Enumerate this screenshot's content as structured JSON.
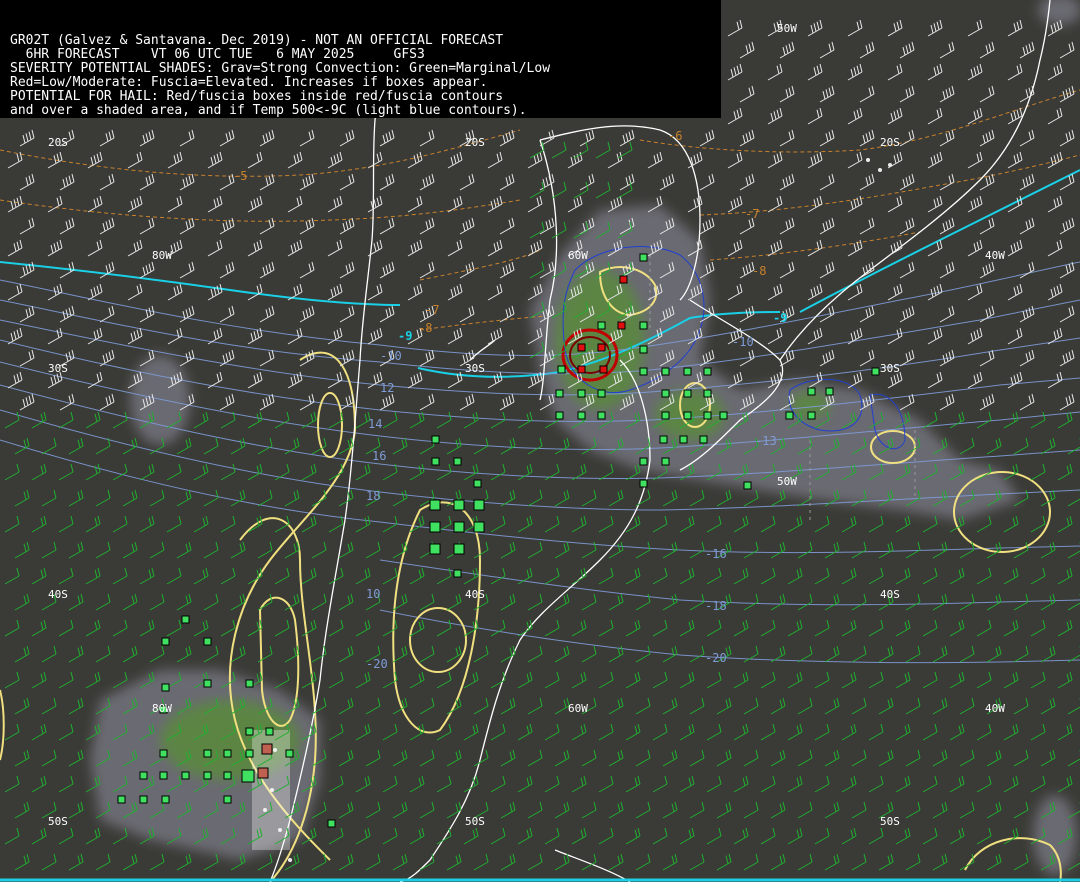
{
  "header": {
    "lines": [
      "GR02T (Galvez & Santavana. Dec 2019) - NOT AN OFFICIAL FORECAST",
      "  6HR FORECAST    VT 06 UTC TUE   6 MAY 2025     GFS3",
      "SEVERITY POTENTIAL SHADES: Grav=Strong Convection: Green=Marginal/Low",
      "Red=Low/Moderate: Fuscia=Elevated. Increases if boxes appear.",
      "POTENTIAL FOR HAIL: Red/fuscia boxes inside red/fuscia contours",
      "and over a shaded area, and if Temp 500<-9C (light blue contours)."
    ]
  },
  "grid_labels": {
    "lat_20s": "20S",
    "lat_30s": "30S",
    "lat_40s": "40S",
    "lat_50s": "50S",
    "lon_80w": "80W",
    "lon_60w": "60W",
    "lon_50w": "50W",
    "lon_40w": "40W"
  },
  "contour_labels": {
    "t_m5": "-5",
    "t_m6": "-6",
    "t_m7": "-7",
    "t_m8": "-8",
    "t_m9": "-9",
    "t_m10": "-10",
    "t_m13": "-13",
    "t_m16": "-16",
    "t_m18": "-18",
    "t_m20": "-20",
    "t_10": "10",
    "t_12": "12",
    "t_14": "14",
    "t_16": "16",
    "t_18": "18"
  },
  "colors": {
    "background": "#3a3a36",
    "shade_gray": "#6a6a72",
    "shade_green": "#5a8a3c",
    "temp_500_light_blue": "#19d0e6",
    "temp_contours": "#7f9cd8",
    "orange_dashed": "#c8822c",
    "yellow_contour": "#f0e080",
    "coast": "#ffffff",
    "wind_barbs": "#20b030",
    "box_green": "#40e060",
    "box_red": "#e01010"
  }
}
